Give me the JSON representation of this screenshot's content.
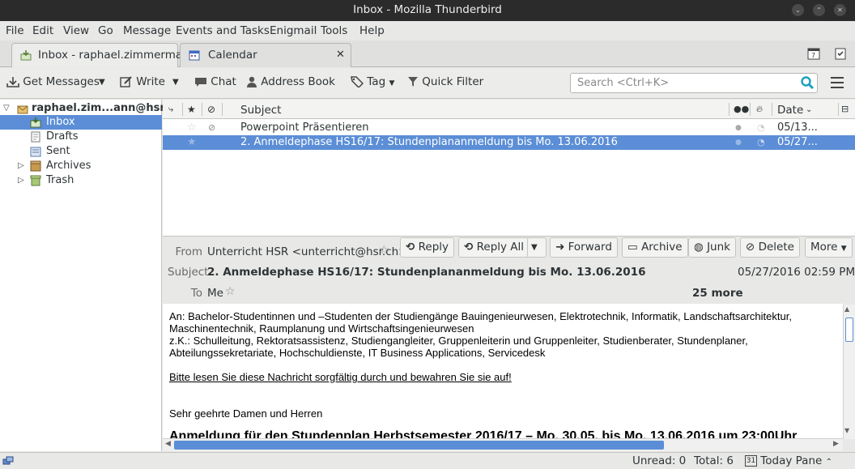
{
  "window": {
    "title": "Inbox - Mozilla Thunderbird"
  },
  "menu": [
    "File",
    "Edit",
    "View",
    "Go",
    "Message",
    "Events and Tasks",
    "Enigmail",
    "Tools",
    "Help"
  ],
  "tabs": [
    {
      "label": "Inbox - raphael.zimmerma..."
    },
    {
      "label": "Calendar"
    }
  ],
  "toolbar": {
    "get_messages": "Get Messages",
    "write": "Write",
    "chat": "Chat",
    "address_book": "Address Book",
    "tag": "Tag",
    "quick_filter": "Quick Filter",
    "search_placeholder": "Search <Ctrl+K>"
  },
  "folders": {
    "account": "raphael.zim...ann@hsr.ch",
    "items": [
      "Inbox",
      "Drafts",
      "Sent",
      "Archives",
      "Trash"
    ]
  },
  "thread": {
    "columns": {
      "subject": "Subject",
      "date": "Date"
    },
    "rows": [
      {
        "subject": "Powerpoint Präsentieren",
        "date": "05/13..."
      },
      {
        "subject": "2. Anmeldephase HS16/17: Stundenplananmeldung bis Mo. 13.06.2016",
        "date": "05/27..."
      }
    ]
  },
  "header": {
    "from_label": "From",
    "from": "Unterricht HSR <unterricht@hsr.ch>",
    "subject_label": "Subject",
    "subject": "2. Anmeldephase HS16/17: Stundenplananmeldung bis Mo. 13.06.2016",
    "date": "05/27/2016 02:59 PM",
    "to_label": "To",
    "to": "Me",
    "more": "25 more",
    "buttons": {
      "reply": "Reply",
      "reply_all": "Reply All",
      "forward": "Forward",
      "archive": "Archive",
      "junk": "Junk",
      "delete": "Delete",
      "more": "More"
    }
  },
  "body": {
    "line1": "An: Bachelor-Studentinnen und –Studenten der Studiengänge Bauingenieurwesen, Elektrotechnik, Informatik, Landschaftsarchitektur,",
    "line2": "Maschinentechnik, Raumplanung und Wirtschaftsingenieurwesen",
    "line3": "z.K.: Schulleitung, Rektoratsassistenz, Studiengangleiter, Gruppenleiterin und Gruppenleiter, Studienberater, Stundenplaner,",
    "line4": "Abteilungssekretariate, Hochschuldienste, IT Business Applications, Servicedesk",
    "notice": "Bitte lesen Sie diese Nachricht sorgfältig durch und bewahren Sie sie auf!",
    "greeting": "Sehr geehrte Damen und Herren",
    "heading": "Anmeldung für den Stundenplan Herbstsemester 2016/17 – Mo. 30.05. bis Mo. 13.06.2016 um 23:00Uhr"
  },
  "status": {
    "unread": "Unread: 0",
    "total": "Total: 6",
    "today_pane": "Today Pane",
    "calendar_day": "31"
  },
  "colors": {
    "selection": "#5b8ed6",
    "titlebar": "#2b2b2b",
    "search_icon": "#1ea1bd"
  }
}
